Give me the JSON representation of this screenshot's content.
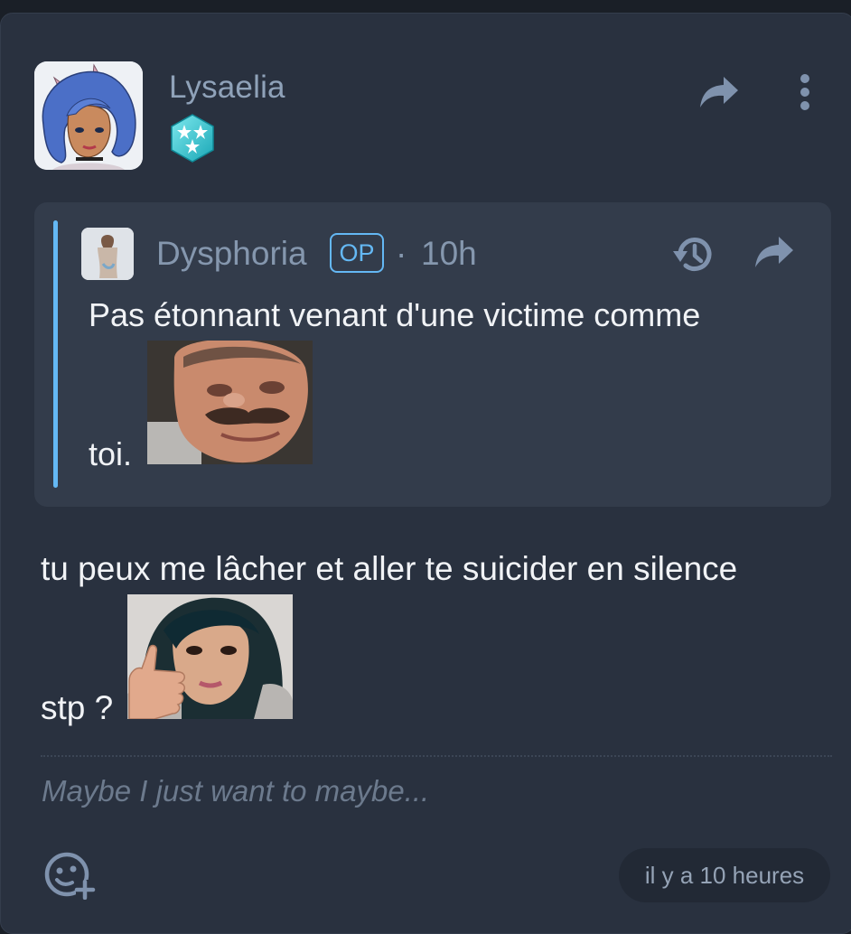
{
  "post": {
    "author": "Lysaelia",
    "author_avatar_icon": "anime-girl-avatar",
    "badge_icon": "stars-hexagon-badge-icon",
    "share_icon": "share-arrow-icon",
    "more_icon": "more-vertical-icon"
  },
  "quote": {
    "author": "Dysphoria",
    "op_label": "OP",
    "separator": "·",
    "time": "10h",
    "text_line1": "Pas étonnant venant d'une victime comme",
    "text_line2": "toi.",
    "sticker": "crying-laughing-man-sticker",
    "accent_color": "#64b8f4"
  },
  "message": {
    "line1": "tu peux me lâcher et aller te suicider en silence",
    "line2": "stp ?",
    "sticker": "girl-thumbs-up-sticker"
  },
  "signature": "Maybe I just want to maybe...",
  "footer": {
    "react_icon": "add-reaction-icon",
    "timestamp": "il y a 10 heures"
  }
}
